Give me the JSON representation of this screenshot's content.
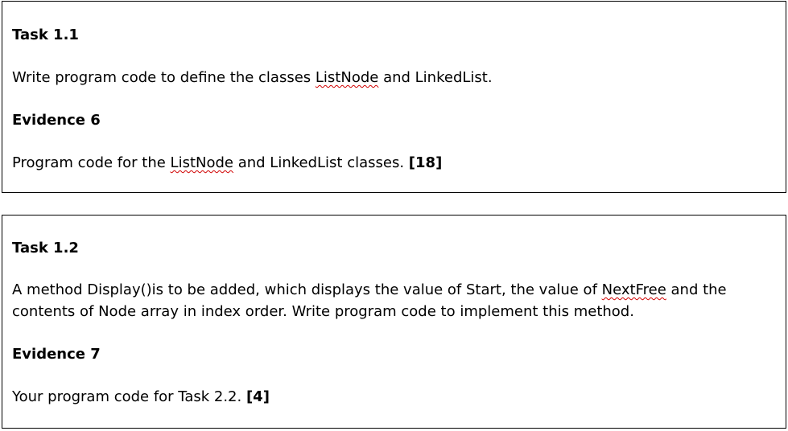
{
  "tasks": [
    {
      "heading": "Task 1.1",
      "body": {
        "before": "Write program code to define the classes ",
        "flagged": "ListNode",
        "after": " and LinkedList."
      },
      "evidence_heading": "Evidence 6",
      "evidence": {
        "before": "Program code for the ",
        "flagged": "ListNode",
        "after": " and LinkedList classes. ",
        "marks": "[18]"
      }
    },
    {
      "heading": "Task 1.2",
      "body": {
        "before": "A method Display()is to be added, which displays the value of Start, the value of ",
        "flagged": "NextFree",
        "after": " and the contents of Node array in index order. Write program code to implement this method."
      },
      "evidence_heading": "Evidence 7",
      "evidence": {
        "before": "Your program code for Task 2.2. ",
        "marks": "[4]"
      }
    }
  ],
  "colors": {
    "text": "#000000",
    "border": "#000000",
    "spellcheck_underline": "#d00000",
    "background": "#ffffff"
  }
}
